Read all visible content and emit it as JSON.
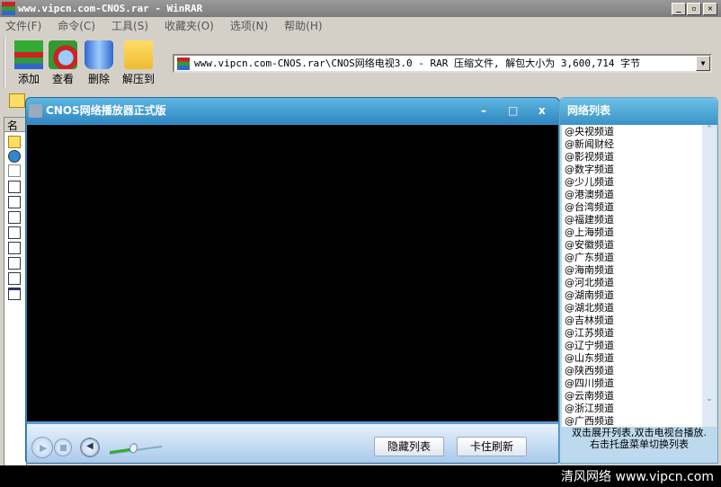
{
  "window": {
    "title": "www.vipcn.com-CNOS.rar - WinRAR"
  },
  "menu": [
    "文件(F)",
    "命令(C)",
    "工具(S)",
    "收藏夹(O)",
    "选项(N)",
    "帮助(H)"
  ],
  "toolbar": {
    "add": "添加",
    "view": "查看",
    "delete": "删除",
    "extract": "解压到"
  },
  "address": {
    "value": "www.vipcn.com-CNOS.rar\\CNOS网络电视3.0 - RAR 压缩文件, 解包大小为 3,600,714 字节"
  },
  "filelist": {
    "header": "名称"
  },
  "player": {
    "title": "CNOS网络播放器正式版",
    "hide_list": "隐藏列表",
    "refresh": "卡住刷新",
    "volume": 0.45
  },
  "panel": {
    "title": "网络列表",
    "channels": [
      "@央视频道",
      "@新闻财经",
      "@影视频道",
      "@数字频道",
      "@少儿频道",
      "@港澳频道",
      "@台湾频道",
      "@福建频道",
      "@上海频道",
      "@安徽频道",
      "@广东频道",
      "@海南频道",
      "@河北频道",
      "@湖南频道",
      "@湖北频道",
      "@吉林频道",
      "@江苏频道",
      "@辽宁频道",
      "@山东频道",
      "@陕西频道",
      "@四川频道",
      "@云南频道",
      "@浙江频道",
      "@广西频道"
    ],
    "hint1": "双击展开列表,双击电视台播放.",
    "hint2": "右击托盘菜单切换列表"
  },
  "watermark": "清风网络 www.vipcn.com"
}
